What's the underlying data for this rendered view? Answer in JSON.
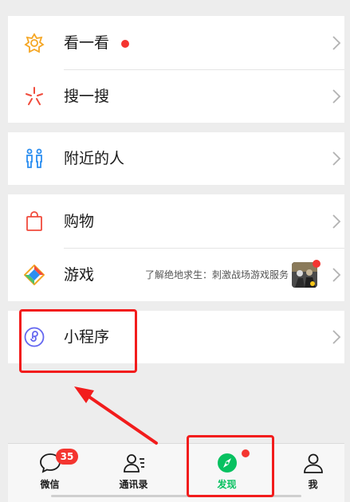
{
  "menu": {
    "look": {
      "label": "看一看"
    },
    "search": {
      "label": "搜一搜"
    },
    "nearby": {
      "label": "附近的人"
    },
    "shop": {
      "label": "购物"
    },
    "games": {
      "label": "游戏",
      "subtitle": "了解绝地求生：刺激战场游戏服务"
    },
    "mini": {
      "label": "小程序"
    }
  },
  "tabbar": {
    "chats": {
      "label": "微信",
      "badge": "35"
    },
    "contacts": {
      "label": "通讯录"
    },
    "discover": {
      "label": "发现"
    },
    "me": {
      "label": "我"
    }
  },
  "colors": {
    "accent": "#07c160",
    "badge": "#f43530",
    "annotation": "#f21c1c"
  }
}
